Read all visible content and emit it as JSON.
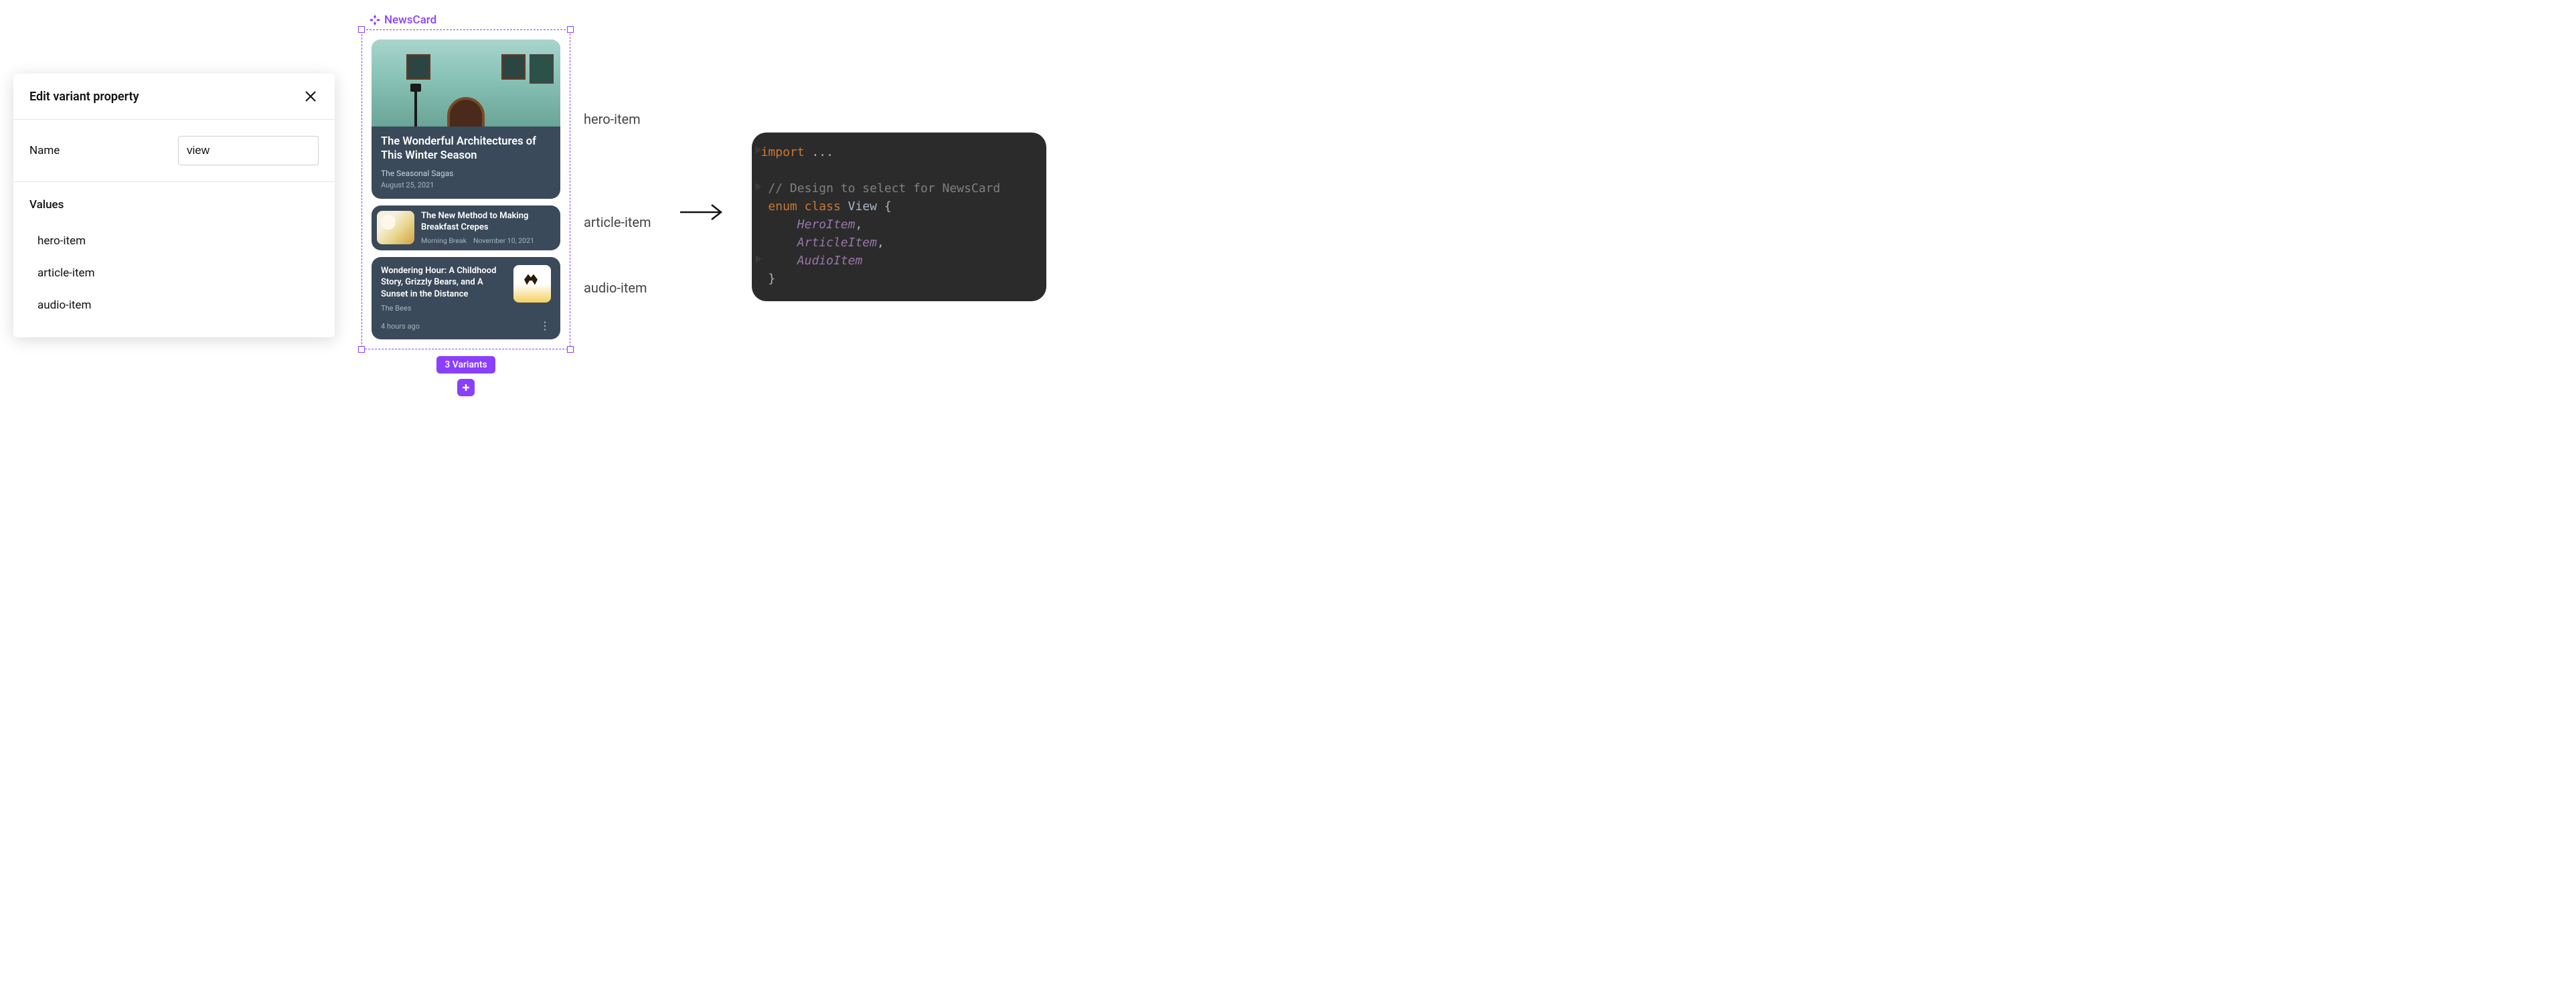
{
  "panel": {
    "title": "Edit variant property",
    "name_label": "Name",
    "name_value": "view",
    "values_heading": "Values",
    "values": [
      "hero-item",
      "article-item",
      "audio-item"
    ]
  },
  "component": {
    "name": "NewsCard",
    "variants_badge": "3 Variants",
    "hero": {
      "title": "The Wonderful Architectures of This Winter Season",
      "subtitle": "The Seasonal Sagas",
      "date": "August 25, 2021"
    },
    "article": {
      "title": "The New Method to Making Breakfast Crepes",
      "source": "Morning Break",
      "date": "November 10, 2021"
    },
    "audio": {
      "title": "Wondering Hour: A Childhood Story, Grizzly Bears, and A Sunset in the Distance",
      "author": "The Bees",
      "time": "4 hours ago"
    }
  },
  "annotations": {
    "a1": "hero-item",
    "a2": "article-item",
    "a3": "audio-item"
  },
  "code": {
    "import_kw": "import",
    "import_rest": " ...",
    "comment": "// Design to select for NewsCard",
    "enum_kw": "enum",
    "class_kw": "class",
    "enum_name": " View {",
    "m1": "HeroItem",
    "m2": "ArticleItem",
    "m3": "AudioItem",
    "comma": ",",
    "close": "}"
  }
}
